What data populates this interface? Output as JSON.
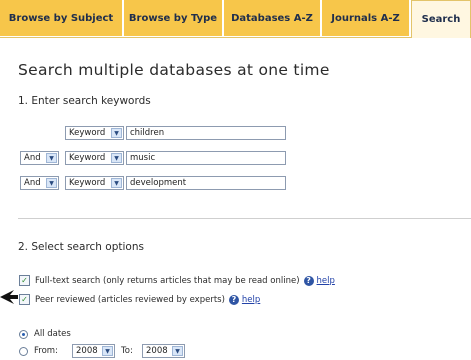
{
  "tabs": [
    "Browse by Subject",
    "Browse by Type",
    "Databases A-Z",
    "Journals A-Z",
    "Search"
  ],
  "title": "Search multiple databases at one time",
  "step1": "1. Enter search keywords",
  "rows": [
    {
      "bool": "",
      "field": "Keyword",
      "value": "children"
    },
    {
      "bool": "And",
      "field": "Keyword",
      "value": "music"
    },
    {
      "bool": "And",
      "field": "Keyword",
      "value": "development"
    }
  ],
  "step2": "2. Select search options",
  "options": [
    {
      "label": "Full-text search (only returns articles that may be read online)",
      "help": "help",
      "checked": true
    },
    {
      "label": "Peer reviewed (articles reviewed by experts)",
      "help": "help",
      "checked": true
    }
  ],
  "dates": {
    "all_label": "All dates",
    "from_label": "From:",
    "from_value": "2008",
    "to_label": "To:",
    "to_value": "2008"
  },
  "icons": {
    "dropdown": "chevron-down-icon",
    "help": "help-icon",
    "pointer": "arrow-pointer-icon"
  },
  "colors": {
    "tab": "#f7c64a",
    "tab_active": "#fff7e1",
    "link": "#2242a8"
  }
}
